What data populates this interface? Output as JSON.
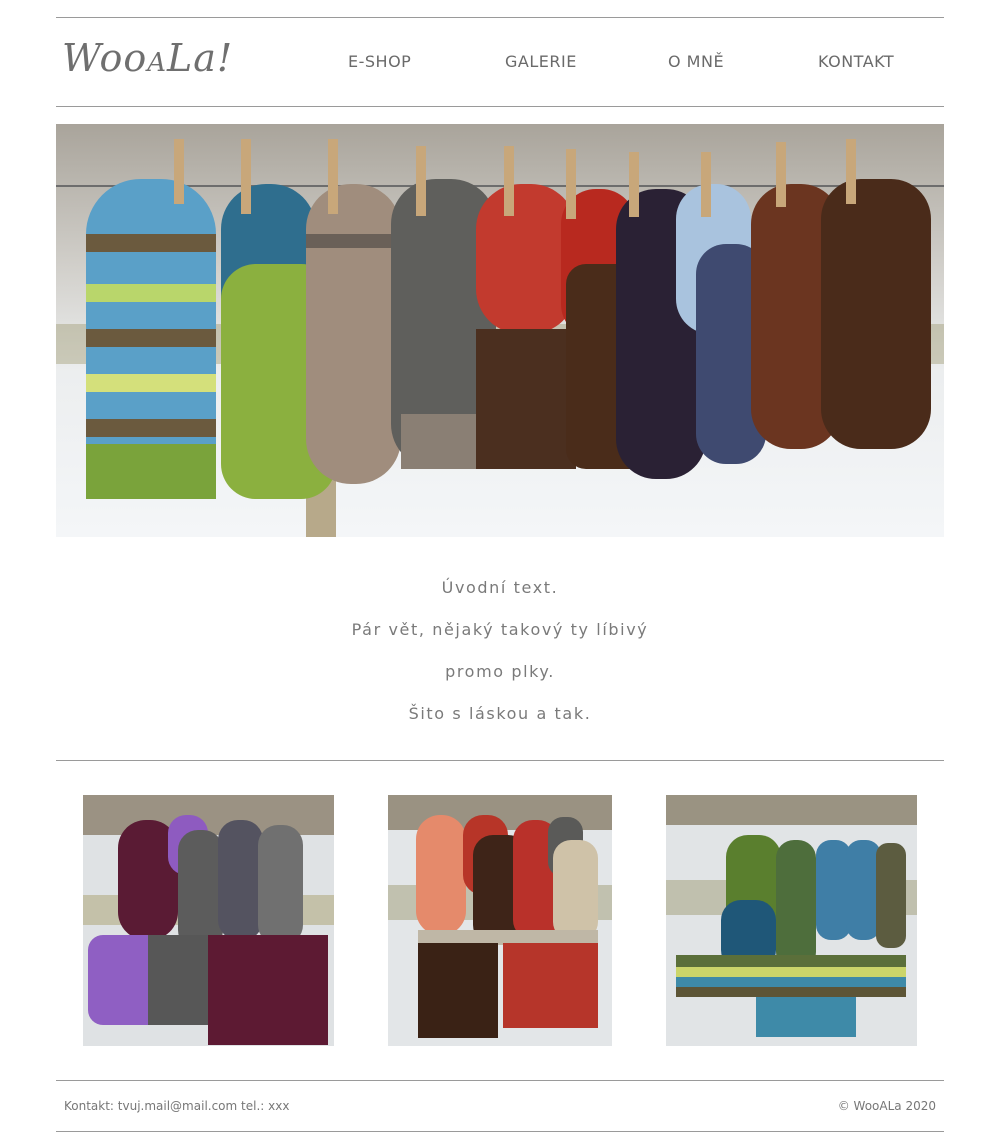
{
  "header": {
    "logo_main": "Woo",
    "logo_small": "A",
    "logo_end": "La!",
    "nav": [
      "E-SHOP",
      "GALERIE",
      "O MNĚ",
      "KONTAKT"
    ]
  },
  "intro": {
    "lines": [
      "Úvodní text.",
      "Pár vět, nějaký takový ty líbivý",
      "promo plky.",
      "Šito s láskou a tak."
    ]
  },
  "footer": {
    "contact": "Kontakt: tvuj.mail@mail.com tel.: xxx",
    "copyright": "© WooALa 2020"
  },
  "colors": {
    "rule": "#9a9a9a",
    "text": "#777777"
  },
  "icons": {
    "hero": "mittens-on-clothesline-photo",
    "thumb1": "purple-grey-mittens-photo",
    "thumb2": "red-brown-mittens-photo",
    "thumb3": "green-blue-striped-mittens-photo"
  }
}
